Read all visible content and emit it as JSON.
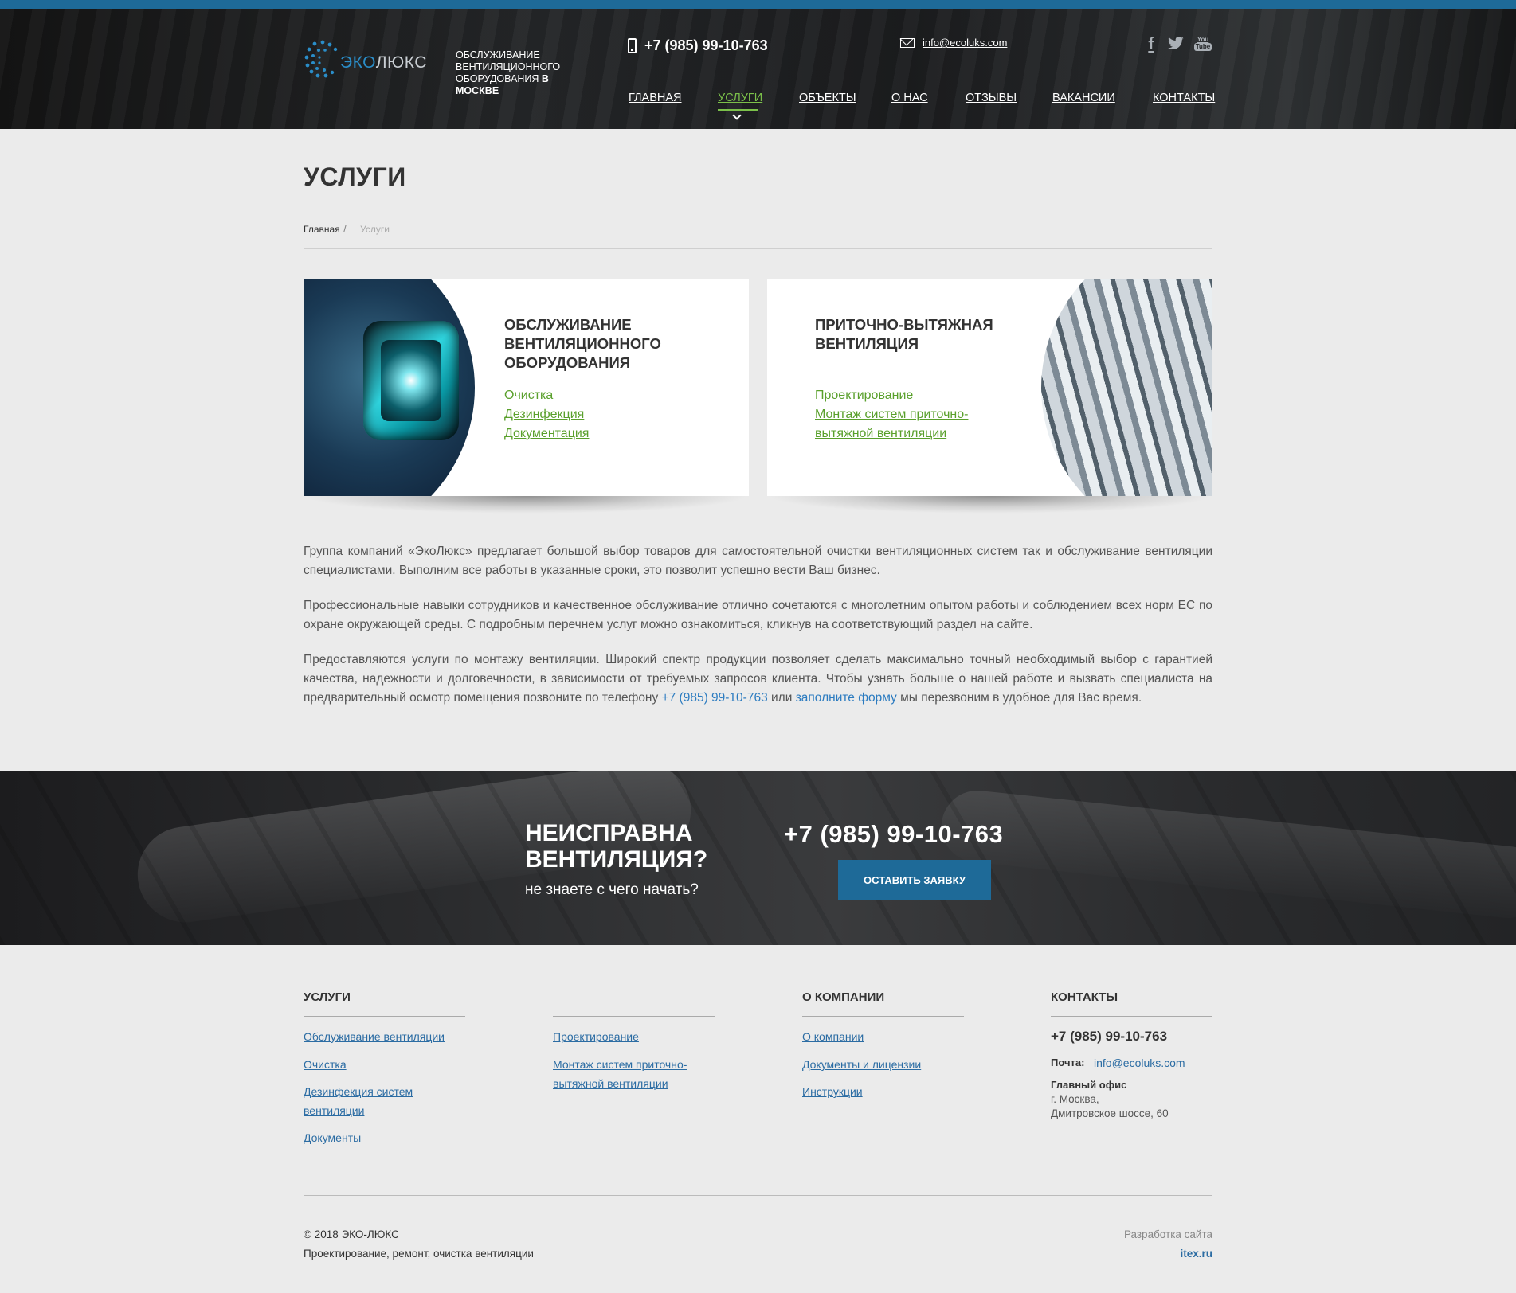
{
  "header": {
    "logo_eko": "ЭКО",
    "logo_lux": "ЛЮКС",
    "tagline_line1": "Обслуживание",
    "tagline_line2": "вентиляционного",
    "tagline_line3": "оборудования",
    "tagline_bold": "в Москве",
    "phone": "+7 (985) 99-10-763",
    "email": "info@ecoluks.com",
    "social_facebook": "f",
    "social_youtube_top": "You",
    "social_youtube_bottom": "Tube",
    "icons": [
      "phone-icon",
      "mail-icon",
      "facebook-icon",
      "twitter-icon",
      "youtube-icon"
    ]
  },
  "nav": {
    "items": [
      "ГЛАВНАЯ",
      "УСЛУГИ",
      "ОБЪЕКТЫ",
      "О НАС",
      "ОТЗЫВЫ",
      "ВАКАНСИИ",
      "КОНТАКТЫ"
    ],
    "active_index": 1,
    "active_color": "#7bc04a"
  },
  "page": {
    "title": "УСЛУГИ",
    "breadcrumb_home": "Главная",
    "breadcrumb_sep": "/",
    "breadcrumb_current": "Услуги"
  },
  "cards": [
    {
      "title_lines": [
        "ОБСЛУЖИВАНИЕ",
        "ВЕНТИЛЯЦИОННОГО",
        "ОБОРУДОВАНИЯ"
      ],
      "links": [
        "Очистка",
        "Дезинфекция",
        "Документация"
      ]
    },
    {
      "title_lines": [
        "ПРИТОЧНО-ВЫТЯЖНАЯ",
        "ВЕНТИЛЯЦИЯ"
      ],
      "links": [
        "Проектирование",
        "Монтаж систем приточно-",
        "вытяжной вентиляции"
      ]
    }
  ],
  "intro": {
    "p1": "Группа компаний «ЭкоЛюкс» предлагает большой выбор товаров для самостоятельной очистки вентиляционных систем так и обслуживание вентиляции специалистами. Выполним все работы в указанные сроки, это позволит успешно вести Ваш бизнес.",
    "p2": "Профессиональные навыки сотрудников и качественное обслуживание отлично сочетаются с многолетним опытом работы и соблюдением всех норм ЕС по охране окружающей среды. С подробным перечнем услуг можно ознакомиться, кликнув на соответствующий раздел на сайте.",
    "p3_start": "Предоставляются услуги по монтажу вентиляции. Широкий спектр продукции позволяет сделать максимально точный необходимый выбор с гарантией качества, надежности и долговечности, в зависимости от требуемых запросов клиента. Чтобы узнать больше о нашей работе и вызвать специалиста на предварительный осмотр помещения позвоните по телефону ",
    "p3_phone": "+7 (985) 99-10-763",
    "p3_mid": " или ",
    "p3_form": "заполните форму",
    "p3_end": " мы перезвоним в удобное для Вас время.",
    "link_color": "#2b7bc0"
  },
  "banner": {
    "title_line1": "НЕИСПРАВНА",
    "title_line2": "ВЕНТИЛЯЦИЯ?",
    "subtitle": "не знаете с чего начать?",
    "phone": "+7 (985) 99-10-763",
    "button": "ОСТАВИТЬ ЗАЯВКУ",
    "button_color": "#1e6a98"
  },
  "footer": {
    "services_head": "УСЛУГИ",
    "services_col1": [
      "Обслуживание вентиляции",
      "Очистка",
      "Дезинфекция систем",
      "вентиляции",
      "Документы"
    ],
    "services_col2": [
      "Проектирование",
      "Монтаж систем приточно-",
      "вытяжной вентиляции"
    ],
    "company_head": "О КОМПАНИИ",
    "company_links": [
      "О компании",
      "Документы и лицензии",
      "Инструкции"
    ],
    "contacts_head": "КОНТАКТЫ",
    "phone": "+7 (985) 99-10-763",
    "mail_label": "Почта:",
    "email": "info@ecoluks.com",
    "office_label": "Главный офис",
    "address_line1": "г. Москва,",
    "address_line2": "Дмитровское шоссе, 60",
    "copyright": "© 2018 ЭКО-ЛЮКС",
    "copyright_sub": "Проектирование, ремонт, очистка вентиляции",
    "dev_label": "Разработка сайта",
    "dev_link": "itex.ru"
  }
}
